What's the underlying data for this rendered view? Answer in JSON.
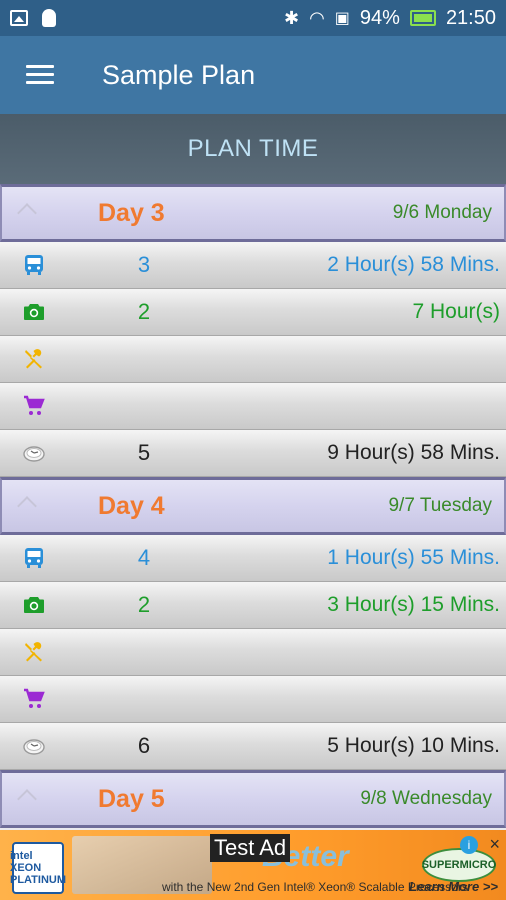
{
  "status_bar": {
    "battery": "94%",
    "time": "21:50"
  },
  "app_bar": {
    "title": "Sample Plan"
  },
  "section": {
    "title": "PLAN TIME"
  },
  "days": [
    {
      "label": "Day 3",
      "date": "9/6 Monday",
      "items": [
        {
          "icon": "bus-icon",
          "count": "3",
          "time": "2 Hour(s) 58 Mins.",
          "color": "#2a8fd8"
        },
        {
          "icon": "camera-icon",
          "count": "2",
          "time": "7 Hour(s)",
          "color": "#1e9e2b"
        },
        {
          "icon": "food-icon",
          "count": "",
          "time": "",
          "color": "#f2b400"
        },
        {
          "icon": "shopping-cart-icon",
          "count": "",
          "time": "",
          "color": "#9b2ad3"
        },
        {
          "icon": "clock-icon",
          "count": "5",
          "time": "9 Hour(s) 58 Mins.",
          "color": "#222222"
        }
      ]
    },
    {
      "label": "Day 4",
      "date": "9/7 Tuesday",
      "items": [
        {
          "icon": "bus-icon",
          "count": "4",
          "time": "1 Hour(s) 55 Mins.",
          "color": "#2a8fd8"
        },
        {
          "icon": "camera-icon",
          "count": "2",
          "time": "3 Hour(s) 15 Mins.",
          "color": "#1e9e2b"
        },
        {
          "icon": "food-icon",
          "count": "",
          "time": "",
          "color": "#f2b400"
        },
        {
          "icon": "shopping-cart-icon",
          "count": "",
          "time": "",
          "color": "#9b2ad3"
        },
        {
          "icon": "clock-icon",
          "count": "6",
          "time": "5 Hour(s) 10 Mins.",
          "color": "#222222"
        }
      ]
    },
    {
      "label": "Day 5",
      "date": "9/8 Wednesday",
      "items": []
    }
  ],
  "ad": {
    "label": "Test Ad",
    "headline": "Better",
    "subline": "with the New 2nd Gen Intel® Xeon® Scalable Processors",
    "cta": "Learn More >>",
    "brand": "SUPERMICRO",
    "chip": "intel XEON PLATINUM"
  }
}
